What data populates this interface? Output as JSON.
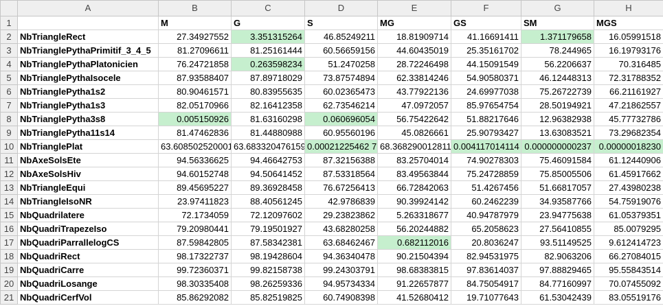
{
  "columns": [
    "A",
    "B",
    "C",
    "D",
    "E",
    "F",
    "G",
    "H"
  ],
  "header_row": {
    "row": "1",
    "cells": [
      "",
      "M",
      "G",
      "S",
      "MG",
      "GS",
      "SM",
      "MGS"
    ]
  },
  "rows": [
    {
      "row": "2",
      "label": "NbTriangleRect",
      "values": [
        "27.34927552",
        "3.351315264",
        "46.85249211",
        "18.81909714",
        "41.16691411",
        "1.371179658",
        "16.05991518"
      ],
      "hl": [
        false,
        true,
        false,
        false,
        false,
        true,
        false
      ]
    },
    {
      "row": "3",
      "label": "NbTrianglePythaPrimitif_3_4_5",
      "values": [
        "81.27096611",
        "81.25161444",
        "60.56659156",
        "44.60435019",
        "25.35161702",
        "78.244965",
        "16.19793176"
      ],
      "hl": [
        false,
        false,
        false,
        false,
        false,
        false,
        false
      ]
    },
    {
      "row": "4",
      "label": "NbTrianglePythaPlatonicien",
      "values": [
        "76.24721858",
        "0.263598234",
        "51.2470258",
        "28.72246498",
        "44.15091549",
        "56.2206637",
        "70.316485"
      ],
      "hl": [
        false,
        true,
        false,
        false,
        false,
        false,
        false
      ]
    },
    {
      "row": "5",
      "label": "NbTrianglePythaIsocele",
      "values": [
        "87.93588407",
        "87.89718029",
        "73.87574894",
        "62.33814246",
        "54.90580371",
        "46.12448313",
        "72.31788352"
      ],
      "hl": [
        false,
        false,
        false,
        false,
        false,
        false,
        false
      ]
    },
    {
      "row": "6",
      "label": "NbTrianglePytha1s2",
      "values": [
        "80.90461571",
        "80.83955635",
        "60.02365473",
        "43.77922136",
        "24.69977038",
        "75.26722739",
        "66.21161927"
      ],
      "hl": [
        false,
        false,
        false,
        false,
        false,
        false,
        false
      ]
    },
    {
      "row": "7",
      "label": "NbTrianglePytha1s3",
      "values": [
        "82.05170966",
        "82.16412358",
        "62.73546214",
        "47.0972057",
        "85.97654754",
        "28.50194921",
        "47.21862557"
      ],
      "hl": [
        false,
        false,
        false,
        false,
        false,
        false,
        false
      ]
    },
    {
      "row": "8",
      "label": "NbTrianglePytha3s8",
      "values": [
        "0.005150926",
        "81.63160298",
        "0.060696054",
        "56.75422642",
        "51.88217646",
        "12.96382938",
        "45.77732786"
      ],
      "hl": [
        true,
        false,
        true,
        false,
        false,
        false,
        false
      ]
    },
    {
      "row": "9",
      "label": "NbTrianglePytha11s14",
      "values": [
        "81.47462836",
        "81.44880988",
        "60.95560196",
        "45.0826661",
        "25.90793427",
        "13.63083521",
        "73.29682354"
      ],
      "hl": [
        false,
        false,
        false,
        false,
        false,
        false,
        false
      ]
    },
    {
      "row": "10",
      "label": "NbTrianglePlat",
      "values": [
        "63.608502520001",
        "63.683320476159",
        "0.00021225462 7",
        "68.368290012811",
        "0.004117014114",
        "0.000000000237",
        "0.00000018230"
      ],
      "hl": [
        false,
        false,
        true,
        false,
        true,
        true,
        true
      ]
    },
    {
      "row": "11",
      "label": "NbAxeSolsEte",
      "values": [
        "94.56336625",
        "94.46642753",
        "87.32156388",
        "83.25704014",
        "74.90278303",
        "75.46091584",
        "61.12440906"
      ],
      "hl": [
        false,
        false,
        false,
        false,
        false,
        false,
        false
      ]
    },
    {
      "row": "12",
      "label": "NbAxeSolsHiv",
      "values": [
        "94.60152748",
        "94.50641452",
        "87.53318564",
        "83.49563844",
        "75.24728859",
        "75.85005506",
        "61.45917662"
      ],
      "hl": [
        false,
        false,
        false,
        false,
        false,
        false,
        false
      ]
    },
    {
      "row": "13",
      "label": "NbTriangleEqui",
      "values": [
        "89.45695227",
        "89.36928458",
        "76.67256413",
        "66.72842063",
        "51.4267456",
        "51.66817057",
        "27.43980238"
      ],
      "hl": [
        false,
        false,
        false,
        false,
        false,
        false,
        false
      ]
    },
    {
      "row": "14",
      "label": "NbTriangleIsoNR",
      "values": [
        "23.97411823",
        "88.40561245",
        "42.9786839",
        "90.39924142",
        "60.2462239",
        "34.93587766",
        "54.75919076"
      ],
      "hl": [
        false,
        false,
        false,
        false,
        false,
        false,
        false
      ]
    },
    {
      "row": "15",
      "label": "NbQuadrilatere",
      "values": [
        "72.1734059",
        "72.12097602",
        "29.23823862",
        "5.263318677",
        "40.94787979",
        "23.94775638",
        "61.05379351"
      ],
      "hl": [
        false,
        false,
        false,
        false,
        false,
        false,
        false
      ]
    },
    {
      "row": "16",
      "label": "NbQuadriTrapezeIso",
      "values": [
        "79.20980441",
        "79.19501927",
        "43.68280258",
        "56.20244882",
        "65.2058623",
        "27.56410855",
        "85.0079295"
      ],
      "hl": [
        false,
        false,
        false,
        false,
        false,
        false,
        false
      ]
    },
    {
      "row": "17",
      "label": "NbQuadriParrallelogCS",
      "values": [
        "87.59842805",
        "87.58342381",
        "63.68462467",
        "0.682112016",
        "20.8036247",
        "93.51149525",
        "9.612414723"
      ],
      "hl": [
        false,
        false,
        false,
        true,
        false,
        false,
        false
      ]
    },
    {
      "row": "18",
      "label": "NbQuadriRect",
      "values": [
        "98.17322737",
        "98.19428604",
        "94.36340478",
        "90.21504394",
        "82.94531975",
        "82.9063206",
        "66.27084015"
      ],
      "hl": [
        false,
        false,
        false,
        false,
        false,
        false,
        false
      ]
    },
    {
      "row": "19",
      "label": "NbQuadriCarre",
      "values": [
        "99.72360371",
        "99.82158738",
        "99.24303791",
        "98.68383815",
        "97.83614037",
        "97.88829465",
        "95.55843514"
      ],
      "hl": [
        false,
        false,
        false,
        false,
        false,
        false,
        false
      ]
    },
    {
      "row": "20",
      "label": "NbQuadriLosange",
      "values": [
        "98.30335408",
        "98.26259336",
        "94.95734334",
        "91.22657877",
        "84.75054917",
        "84.77160997",
        "70.07455092"
      ],
      "hl": [
        false,
        false,
        false,
        false,
        false,
        false,
        false
      ]
    },
    {
      "row": "21",
      "label": "NbQuadriCerfVol",
      "values": [
        "85.86292082",
        "85.82519825",
        "60.74908398",
        "41.52680412",
        "19.71077643",
        "61.53042439",
        "83.05519176"
      ],
      "hl": [
        false,
        false,
        false,
        false,
        false,
        false,
        false
      ]
    }
  ],
  "colors": {
    "highlight": "#c6efce",
    "header_bg": "#efefef",
    "grid": "#d4d4d4"
  }
}
